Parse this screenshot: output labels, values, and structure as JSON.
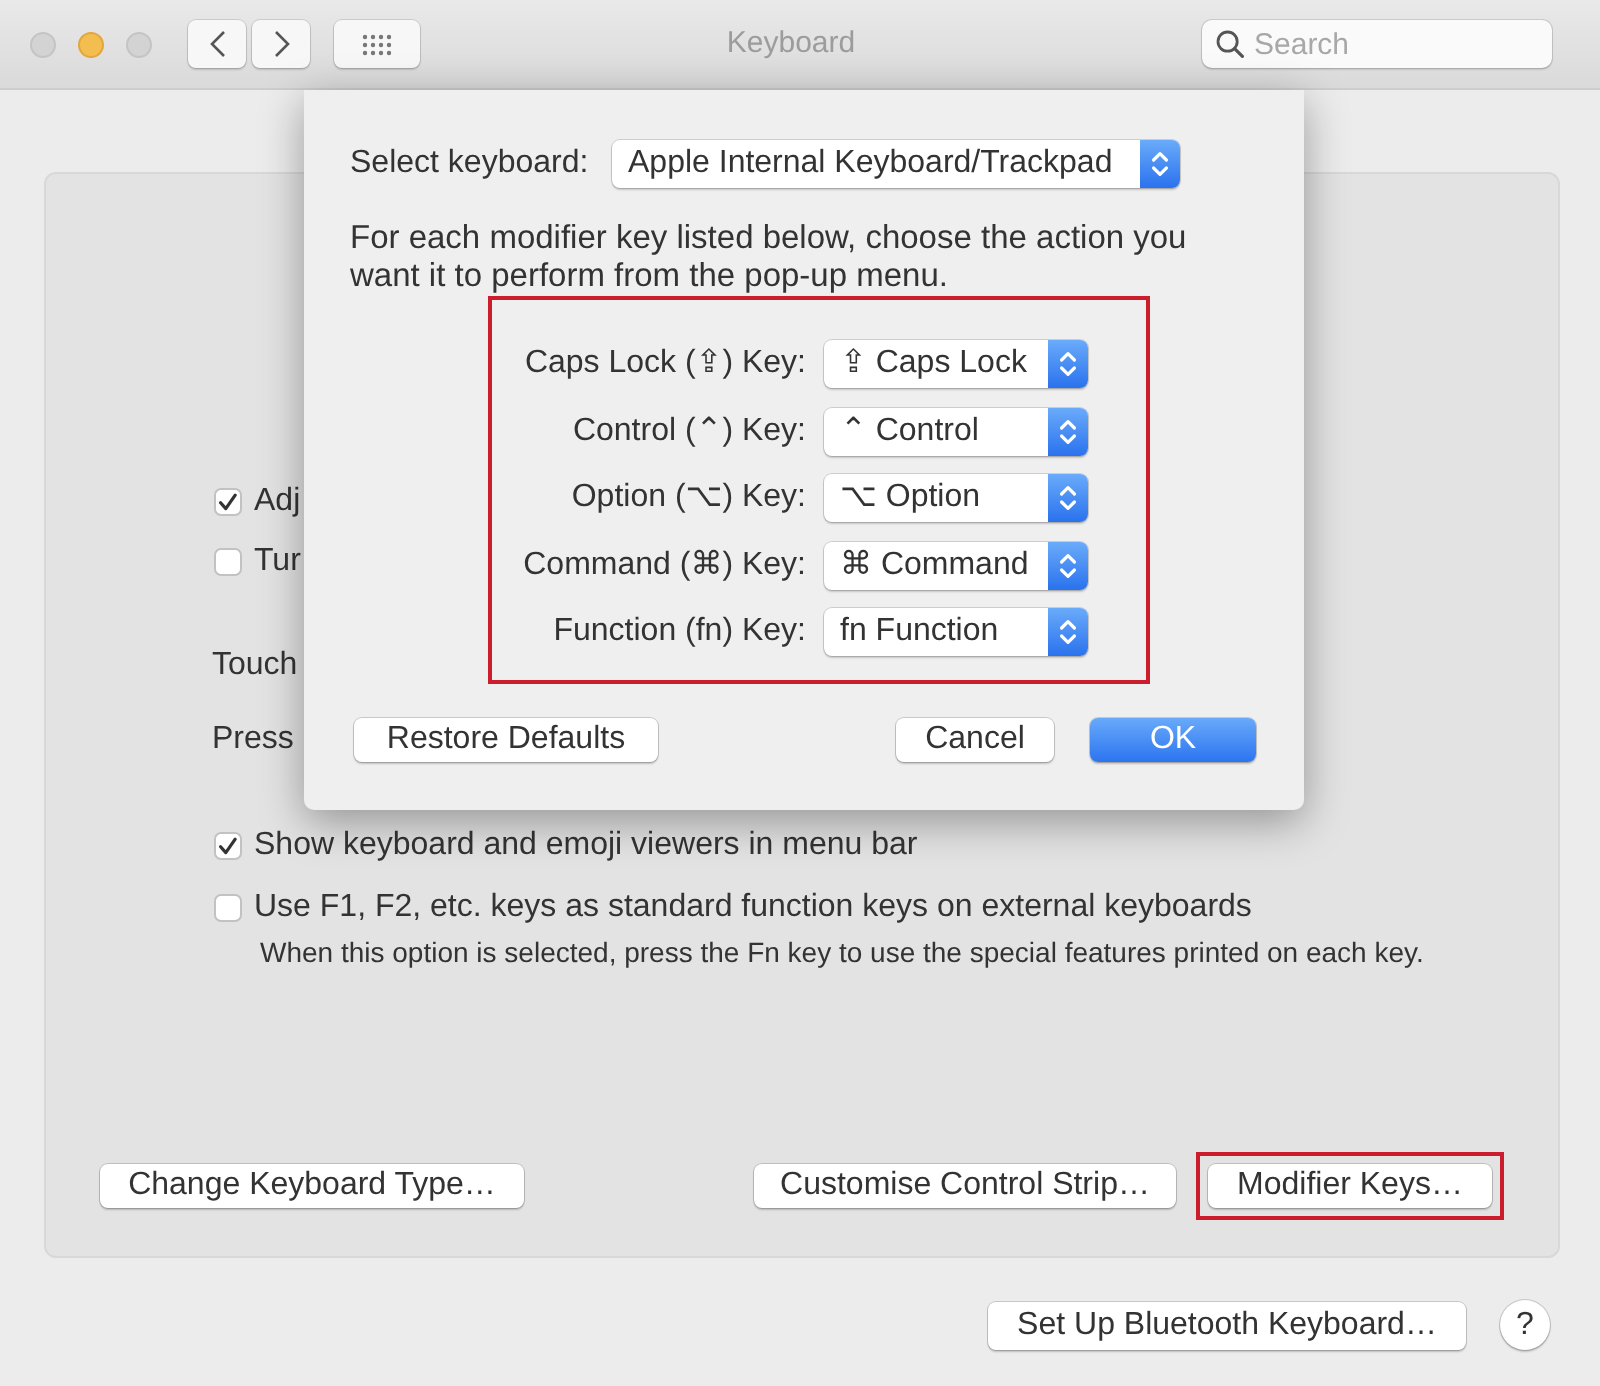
{
  "window": {
    "title": "Keyboard",
    "search": {
      "placeholder": "Search"
    }
  },
  "background_options": [
    {
      "kind": "checkbox",
      "label": "Adj",
      "checked": true
    },
    {
      "kind": "checkbox",
      "label": "Tur",
      "checked": false
    },
    {
      "kind": "text",
      "label": "Touch"
    },
    {
      "kind": "text",
      "label": "Press"
    }
  ],
  "options": [
    {
      "label": "Show keyboard and emoji viewers in menu bar",
      "checked": true
    },
    {
      "label": "Use F1, F2, etc. keys as standard function keys on external keyboards",
      "checked": false,
      "note": "When this option is selected, press the Fn key to use the special features printed on each key."
    }
  ],
  "panel_buttons": [
    {
      "label": "Change Keyboard Type…",
      "highlighted": false
    },
    {
      "label": "Customise Control Strip…",
      "highlighted": false
    },
    {
      "label": "Modifier Keys…",
      "highlighted": true
    }
  ],
  "footer": {
    "button": "Set Up Bluetooth Keyboard…",
    "help": "?"
  },
  "sheet": {
    "keyboard_select": {
      "label": "Select keyboard:",
      "value": "Apple Internal Keyboard/Trackpad"
    },
    "description": "For each modifier key listed below, choose the action you want it to perform from the pop-up menu.",
    "modifier_keys": {
      "highlighted": true,
      "rows": [
        {
          "label": "Caps Lock (⇪) Key:",
          "action": "⇪ Caps Lock"
        },
        {
          "label": "Control (⌃) Key:",
          "action": "⌃ Control"
        },
        {
          "label": "Option (⌥) Key:",
          "action": "⌥ Option"
        },
        {
          "label": "Command (⌘) Key:",
          "action": "⌘ Command"
        },
        {
          "label": "Function (fn) Key:",
          "action": "fn Function"
        }
      ]
    },
    "buttons": [
      {
        "label": "Restore Defaults",
        "kind": "normal"
      },
      {
        "label": "Cancel",
        "kind": "normal"
      },
      {
        "label": "OK",
        "kind": "default"
      }
    ]
  }
}
